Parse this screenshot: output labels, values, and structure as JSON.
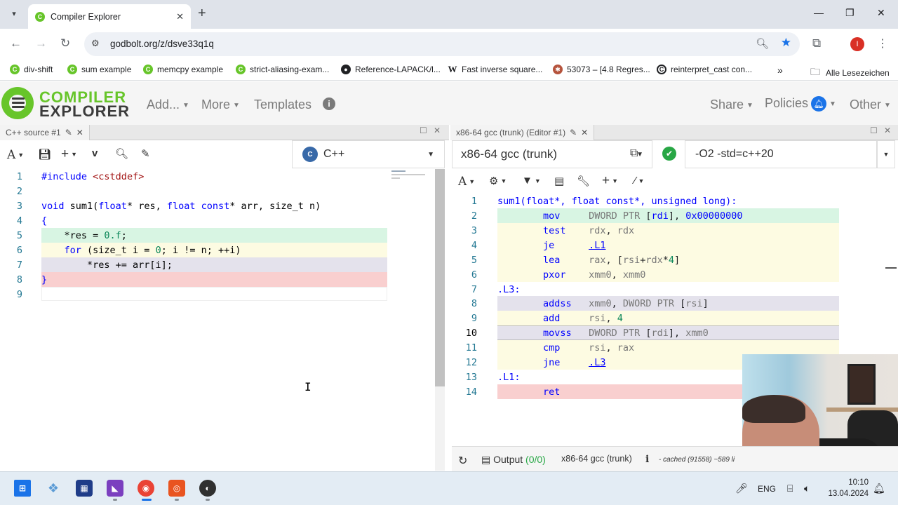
{
  "browser": {
    "tab_title": "Compiler Explorer",
    "url": "godbolt.org/z/dsve33q1q",
    "profile_initial": "I",
    "bookmarks": [
      {
        "label": "div-shift",
        "icon": "ce-icon"
      },
      {
        "label": "sum example",
        "icon": "ce-icon"
      },
      {
        "label": "memcpy example",
        "icon": "ce-icon"
      },
      {
        "label": "strict-aliasing-exam...",
        "icon": "ce-icon"
      },
      {
        "label": "Reference-LAPACK/l...",
        "icon": "github-icon"
      },
      {
        "label": "Fast inverse square...",
        "icon": "wikipedia-icon"
      },
      {
        "label": "53073 – [4.8 Regres...",
        "icon": "bugzilla-icon"
      },
      {
        "label": "reinterpret_cast con...",
        "icon": "cppreference-icon"
      }
    ],
    "overflow": "»",
    "all_bookmarks": "Alle Lesezeichen"
  },
  "ce": {
    "logo_line1": "COMPILER",
    "logo_line2": "EXPLORER",
    "menu_add": "Add...",
    "menu_more": "More",
    "menu_templates": "Templates",
    "menu_share": "Share",
    "menu_policies": "Policies",
    "menu_other": "Other"
  },
  "source_pane": {
    "tab": "C++ source #1",
    "language": "C++",
    "language_badge": "C",
    "lines": [
      "1",
      "2",
      "3",
      "4",
      "5",
      "6",
      "7",
      "8",
      "9"
    ]
  },
  "compiler_pane": {
    "tab": "x86-64 gcc (trunk) (Editor #1)",
    "compiler": "x86-64 gcc (trunk)",
    "options": "-O2  -std=c++20",
    "lines": [
      "1",
      "2",
      "3",
      "4",
      "5",
      "6",
      "7",
      "8",
      "9",
      "10",
      "11",
      "12",
      "13",
      "14"
    ],
    "output_label": "Output",
    "output_count": "(0/0)",
    "compiler_name_footer": "x86-64 gcc (trunk)",
    "info": "i",
    "cached": "- cached (91558) ~589 li"
  },
  "taskbar": {
    "lang": "ENG",
    "time": "10:10",
    "date": "13.04.2024"
  },
  "colors": {
    "ce_green": "#67c52a",
    "line_green": "#d8f5e3",
    "line_yellow": "#fdfbe2",
    "line_purple": "#e4e2ec",
    "line_red": "#f9cfcf"
  }
}
